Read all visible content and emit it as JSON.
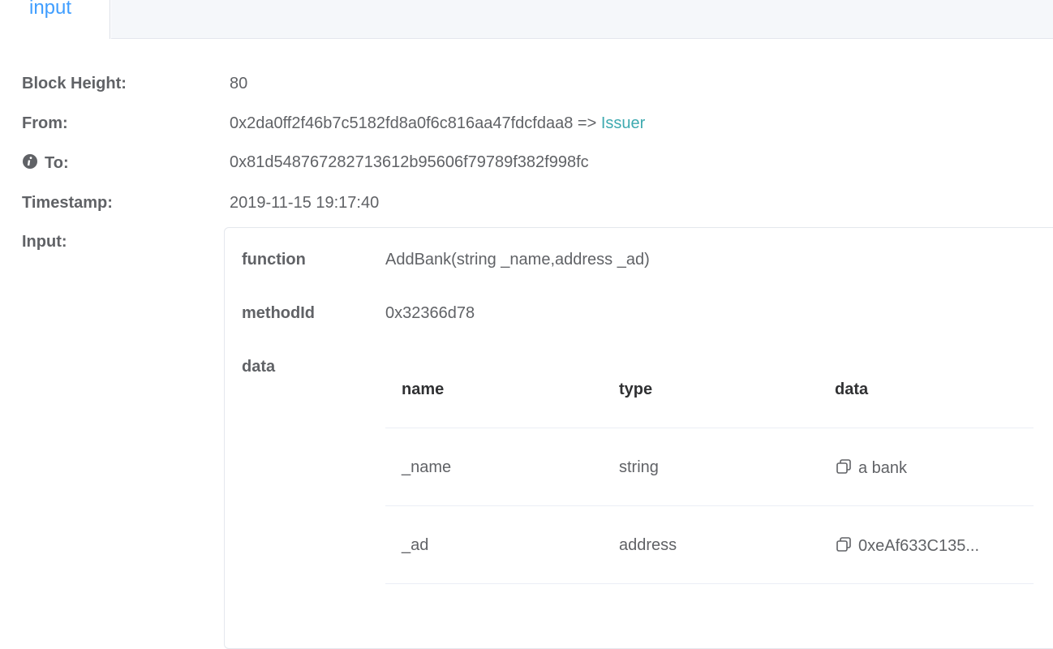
{
  "tabs": {
    "active_label": "input"
  },
  "details": {
    "block_height": {
      "label": "Block Height:",
      "value": "80"
    },
    "from": {
      "label": "From:",
      "address": "0x2da0ff2f46b7c5182fd8a0f6c816aa47fdcfdaa8",
      "arrow": "=>",
      "link": "Issuer"
    },
    "to": {
      "label": "To:",
      "value": "0x81d548767282713612b95606f79789f382f998fc",
      "icon": "info-icon"
    },
    "timestamp": {
      "label": "Timestamp:",
      "value": "2019-11-15 19:17:40"
    },
    "input": {
      "label": "Input:"
    }
  },
  "input_box": {
    "function": {
      "label": "function",
      "value": "AddBank(string _name,address _ad)"
    },
    "method_id": {
      "label": "methodId",
      "value": "0x32366d78"
    },
    "data": {
      "label": "data"
    },
    "table": {
      "headers": [
        "name",
        "type",
        "data"
      ],
      "rows": [
        {
          "name": "_name",
          "type": "string",
          "data": "a bank",
          "icon": "copy-icon"
        },
        {
          "name": "_ad",
          "type": "address",
          "data": "0xeAf633C135...",
          "icon": "copy-icon"
        }
      ]
    }
  }
}
